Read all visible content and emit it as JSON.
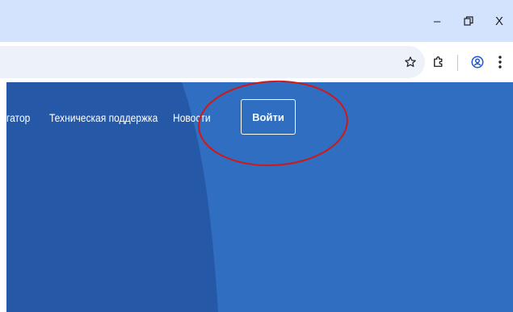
{
  "window_controls": {
    "minimize": "–",
    "restore": "⧉",
    "close": "X"
  },
  "toolbar": {
    "bookmark_icon": "star-icon",
    "extensions_icon": "puzzle-icon",
    "profile_icon": "profile-icon",
    "menu_icon": "kebab-menu-icon"
  },
  "site": {
    "nav": {
      "items": [
        {
          "label": "гатор"
        },
        {
          "label": "Техническая поддержка"
        },
        {
          "label": "Новости"
        }
      ],
      "login_label": "Войти"
    },
    "colors": {
      "background": "#2f6ec0",
      "background_dark": "#2559a8"
    }
  },
  "annotation": {
    "color": "#d01818",
    "shape": "ellipse",
    "highlights": "login-button"
  }
}
